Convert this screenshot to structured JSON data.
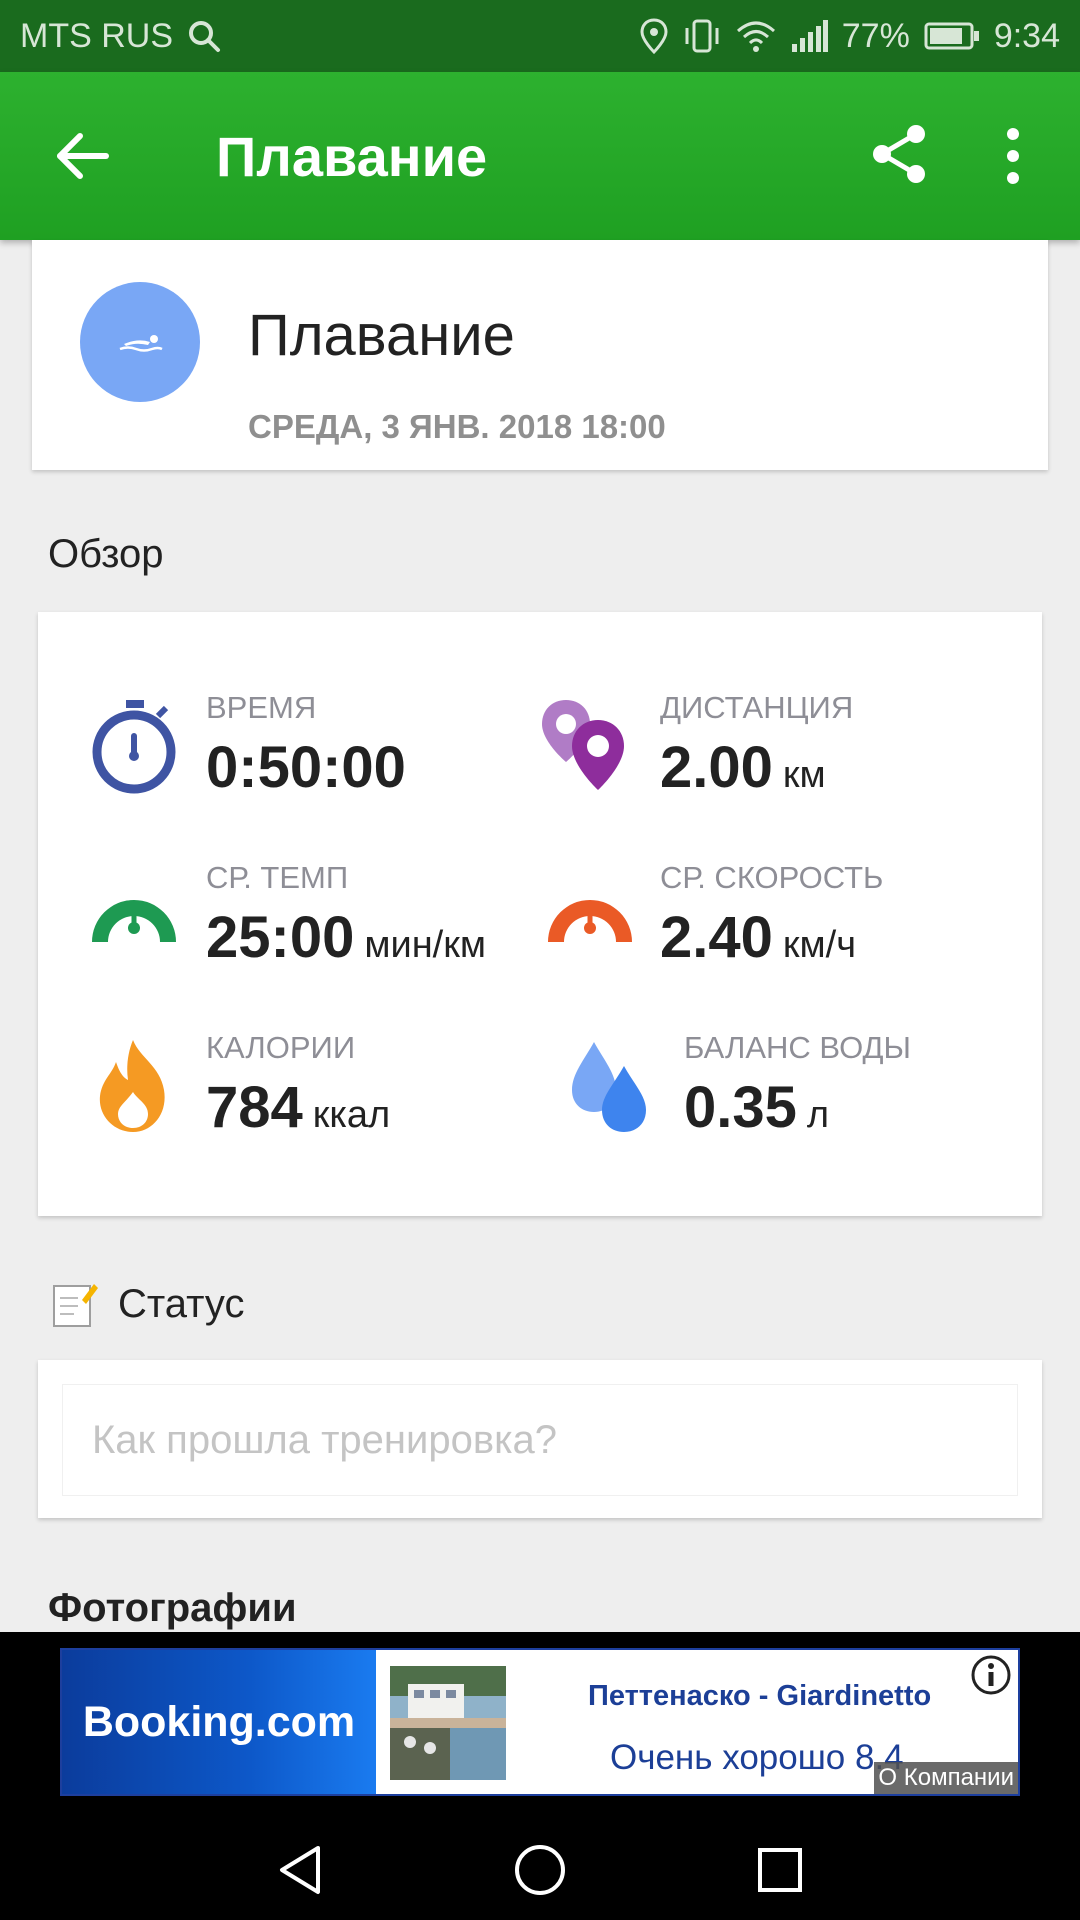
{
  "status_bar": {
    "carrier": "MTS RUS",
    "battery": "77%",
    "time": "9:34"
  },
  "app_bar": {
    "title": "Плавание"
  },
  "activity": {
    "title": "Плавание",
    "datetime": "СРЕДА, 3 ЯНВ. 2018 18:00"
  },
  "overview": {
    "heading": "Обзор",
    "metrics": [
      {
        "label": "ВРЕМЯ",
        "value": "0:50:00",
        "unit": "",
        "icon": "stopwatch-icon",
        "color": "#3f54a3"
      },
      {
        "label": "ДИСТАНЦИЯ",
        "value": "2.00",
        "unit": "км",
        "icon": "location-pins-icon",
        "color": "#8e3fa6"
      },
      {
        "label": "СР. ТЕМП",
        "value": "25:00",
        "unit": "мин/км",
        "icon": "pace-gauge-icon",
        "color": "#1e9a52"
      },
      {
        "label": "СР. СКОРОСТЬ",
        "value": "2.40",
        "unit": "км/ч",
        "icon": "speed-gauge-icon",
        "color": "#ea5a26"
      },
      {
        "label": "КАЛОРИИ",
        "value": "784",
        "unit": "ккал",
        "icon": "flame-icon",
        "color": "#f59a23"
      },
      {
        "label": "БАЛАНС ВОДЫ",
        "value": "0.35",
        "unit": "л",
        "icon": "water-drops-icon",
        "color": "#4a8ef0"
      }
    ]
  },
  "status_section": {
    "heading": "Статус",
    "placeholder": "Как прошла тренировка?",
    "value": ""
  },
  "photos_section": {
    "heading": "Фотографии"
  },
  "ad": {
    "brand": "Booking.com",
    "hotel": "Петтенаско - Giardinetto",
    "rating": "Очень хорошо 8.4",
    "about": "О Компании"
  },
  "colors": {
    "status_bar": "#1a6b1e",
    "app_bar": "#2db12f",
    "activity_circle": "#79a7f5"
  }
}
